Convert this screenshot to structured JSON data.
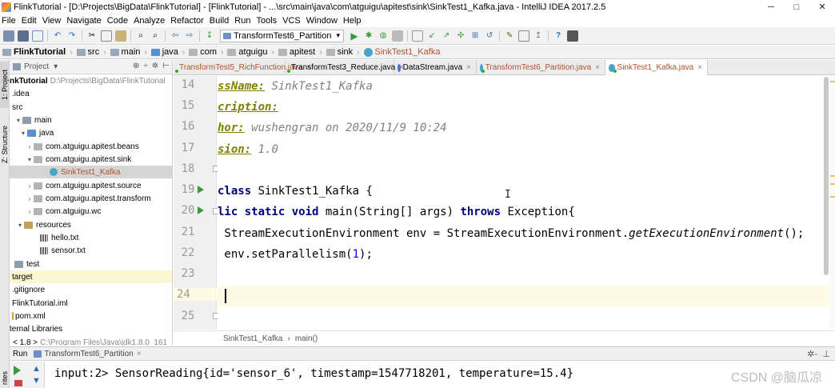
{
  "window": {
    "title": "FlinkTutorial - [D:\\Projects\\BigData\\FlinkTutorial] - [FlinkTutorial] - ...\\src\\main\\java\\com\\atguigu\\apitest\\sink\\SinkTest1_Kafka.java - IntelliJ IDEA 2017.2.5",
    "minimize": "─",
    "maximize": "□",
    "close": "✕"
  },
  "menu": [
    "File",
    "Edit",
    "View",
    "Navigate",
    "Code",
    "Analyze",
    "Refactor",
    "Build",
    "Run",
    "Tools",
    "VCS",
    "Window",
    "Help"
  ],
  "toolbar": {
    "run_config": "TransformTest6_Partition"
  },
  "breadcrumb": [
    "FlinkTutorial",
    "src",
    "main",
    "java",
    "com",
    "atguigu",
    "apitest",
    "sink",
    "SinkTest1_Kafka"
  ],
  "left_strip": {
    "project_tab": "1: Project",
    "structure_tab": "Z: Structure",
    "favorites_tab": "rites"
  },
  "project_panel": {
    "title": "Project",
    "tools": [
      "▾",
      "⊕",
      "÷",
      "✲",
      "⊢"
    ],
    "root": {
      "name": "nkTutorial",
      "path": "D:\\Projects\\BigData\\FlinkTutorial"
    },
    "items": [
      {
        "label": ".idea"
      },
      {
        "label": "src"
      },
      {
        "label": "main"
      },
      {
        "label": "java"
      },
      {
        "label": "com.atguigu.apitest.beans"
      },
      {
        "label": "com.atguigu.apitest.sink"
      },
      {
        "label": "SinkTest1_Kafka"
      },
      {
        "label": "com.atguigu.apitest.source"
      },
      {
        "label": "com.atguigu.apitest.transform"
      },
      {
        "label": "com.atguigu.wc"
      },
      {
        "label": "resources"
      },
      {
        "label": "hello.txt"
      },
      {
        "label": "sensor.txt"
      },
      {
        "label": "test"
      },
      {
        "label": "target"
      },
      {
        "label": ".gitignore"
      },
      {
        "label": "FlinkTutorial.iml"
      },
      {
        "label": "pom.xml"
      },
      {
        "label": "ternal Libraries"
      },
      {
        "label": "< 1.8 >",
        "path": "C:\\Program Files\\Java\\jdk1.8.0_161"
      }
    ]
  },
  "tabs": [
    {
      "label": "TransformTest5_RichFunction.java",
      "x": "×"
    },
    {
      "label": "TransformTest3_Reduce.java",
      "x": "×"
    },
    {
      "label": "DataStream.java",
      "x": "×"
    },
    {
      "label": "TransformTest6_Partition.java",
      "x": "×"
    },
    {
      "label": "SinkTest1_Kafka.java",
      "x": "×"
    }
  ],
  "editor": {
    "lines": [
      {
        "n": "14",
        "t1": "ssName:",
        "t2": " SinkTest1_Kafka"
      },
      {
        "n": "15",
        "t1": "cription:",
        "t2": ""
      },
      {
        "n": "16",
        "t1": "hor:",
        "t2": " wushengran on 2020/11/9 10:24"
      },
      {
        "n": "17",
        "t1": "sion:",
        "t2": " 1.0"
      },
      {
        "n": "18"
      },
      {
        "n": "19",
        "kw": "class",
        "rest": " SinkTest1_Kafka {"
      },
      {
        "n": "20",
        "kw1": "lic static void",
        "mid": " main(String[] args) ",
        "kw2": "throws",
        "rest": " Exception{"
      },
      {
        "n": "21",
        "a": " StreamExecutionEnvironment env = StreamExecutionEnvironment.",
        "b": "getExecutionEnvironment",
        "c": "();"
      },
      {
        "n": "22",
        "a": " env.setParallelism(",
        "b": "1",
        "c": ");"
      },
      {
        "n": "23"
      },
      {
        "n": "24"
      },
      {
        "n": "25"
      }
    ],
    "crumb": [
      "SinkTest1_Kafka",
      "main()"
    ],
    "mouse_cursor": "I"
  },
  "run_panel": {
    "label": "Run",
    "tab": "TransformTest6_Partition",
    "tab_close": "×",
    "gear": "✲-",
    "hide": "⊥",
    "up": "▲",
    "down": "▼",
    "output": "input:2> SensorReading{id='sensor_6', timestamp=1547718201, temperature=15.4}",
    "watermark": "CSDN @脑瓜凉"
  }
}
